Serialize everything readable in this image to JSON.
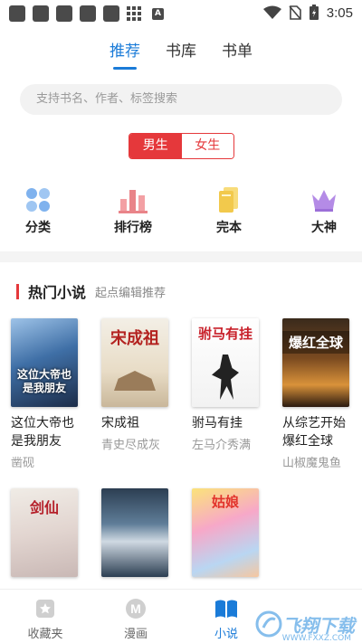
{
  "status_bar": {
    "time": "3:05",
    "keyboard_badge": "A"
  },
  "top_tabs": [
    {
      "label": "推荐",
      "active": true
    },
    {
      "label": "书库",
      "active": false
    },
    {
      "label": "书单",
      "active": false
    }
  ],
  "search": {
    "placeholder": "支持书名、作者、标签搜索"
  },
  "gender_toggle": {
    "male": "男生",
    "female": "女生",
    "selected": "男生"
  },
  "categories": [
    {
      "label": "分类",
      "icon": "category-dots-icon"
    },
    {
      "label": "排行榜",
      "icon": "ranking-bars-icon"
    },
    {
      "label": "完本",
      "icon": "book-stack-icon"
    },
    {
      "label": "大神",
      "icon": "crown-icon"
    }
  ],
  "hot_section": {
    "title": "热门小说",
    "subtitle": "起点编辑推荐"
  },
  "books_row1": [
    {
      "title": "这位大帝也是我朋友",
      "author": "凿砚",
      "cover_text": "这位大帝也是我朋友"
    },
    {
      "title": "宋成祖",
      "author": "青史尽成灰",
      "cover_text": "宋成祖"
    },
    {
      "title": "驸马有挂",
      "author": "左马介秀满",
      "cover_text": "驸马有挂"
    },
    {
      "title": "从综艺开始爆红全球",
      "author": "山椒魔鬼鱼",
      "cover_text": "爆红全球"
    }
  ],
  "books_row2_covers": [
    {
      "cover_text": "剑仙"
    },
    {
      "cover_text": ""
    },
    {
      "cover_text": "姑娘"
    }
  ],
  "bottom_nav": [
    {
      "label": "收藏夹",
      "icon": "bookmark-icon",
      "active": false
    },
    {
      "label": "漫画",
      "icon": "manga-m-icon",
      "active": false
    },
    {
      "label": "小说",
      "icon": "open-book-icon",
      "active": true
    }
  ],
  "watermark": {
    "text": "飞翔下载",
    "url": "WWW.FXXZ.COM"
  },
  "colors": {
    "accent": "#1a7bd8",
    "red": "#e5383b",
    "background": "#ffffff"
  }
}
